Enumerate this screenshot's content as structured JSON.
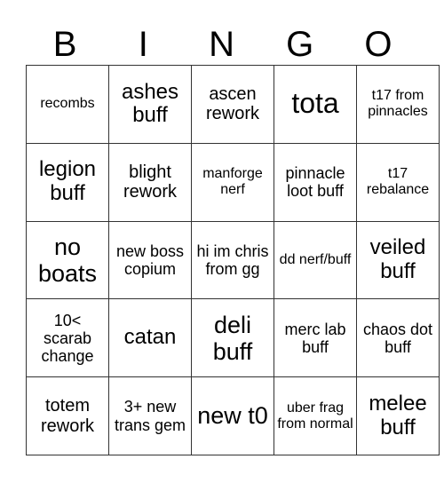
{
  "header": [
    "B",
    "I",
    "N",
    "G",
    "O"
  ],
  "rows": [
    [
      "recombs",
      "ashes buff",
      "ascen rework",
      "tota",
      "t17 from pinnacles"
    ],
    [
      "legion buff",
      "blight rework",
      "manforge nerf",
      "pinnacle loot buff",
      "t17 rebalance"
    ],
    [
      "no boats",
      "new boss copium",
      "hi im chris from gg",
      "dd nerf/buff",
      "veiled buff"
    ],
    [
      "10< scarab change",
      "catan",
      "deli buff",
      "merc lab buff",
      "chaos dot buff"
    ],
    [
      "totem rework",
      "3+ new trans gem",
      "new t0",
      "uber frag from normal",
      "melee buff"
    ]
  ]
}
